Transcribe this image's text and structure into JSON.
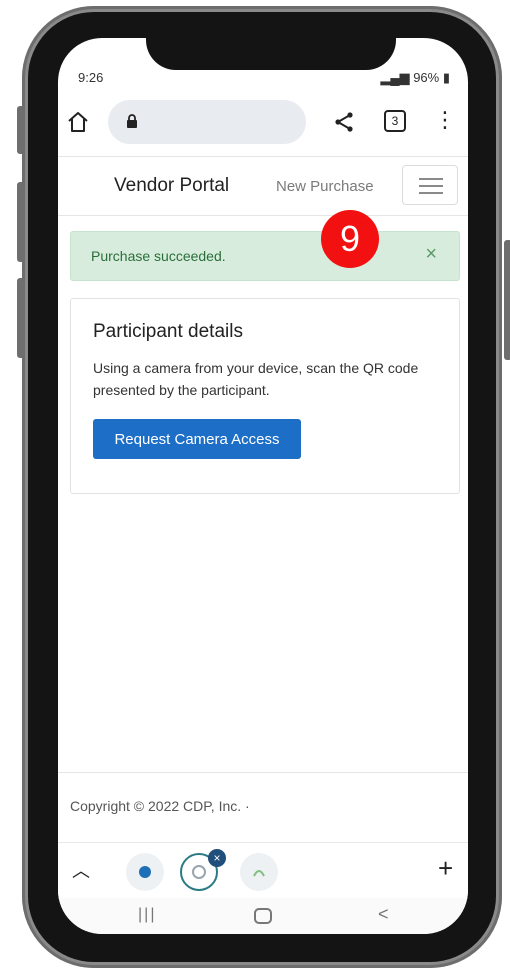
{
  "status_bar": {
    "time": "9:26",
    "battery": "96%"
  },
  "browser": {
    "tab_count": "3"
  },
  "nav": {
    "brand": "Vendor Portal",
    "link": "New Purchase"
  },
  "step_badge": "9",
  "alert": {
    "message": "Purchase succeeded.",
    "close_glyph": "×"
  },
  "card": {
    "title": "Participant details",
    "text": "Using a camera from your device, scan the QR code presented by the participant.",
    "button_label": "Request Camera Access"
  },
  "footer": {
    "copyright": "Copyright © 2022 CDP, Inc. ·"
  },
  "tabstrip": {
    "close_glyph": "×"
  },
  "icons": [
    "home-icon",
    "lock-icon",
    "share-icon",
    "tabs-icon",
    "menu-dots-icon",
    "hamburger-icon",
    "chevron-up-icon",
    "plus-icon"
  ],
  "colors": {
    "alert_bg": "#d7ecdd",
    "alert_text": "#2a6f3a",
    "primary": "#1c6ec6",
    "badge": "#f21010"
  }
}
